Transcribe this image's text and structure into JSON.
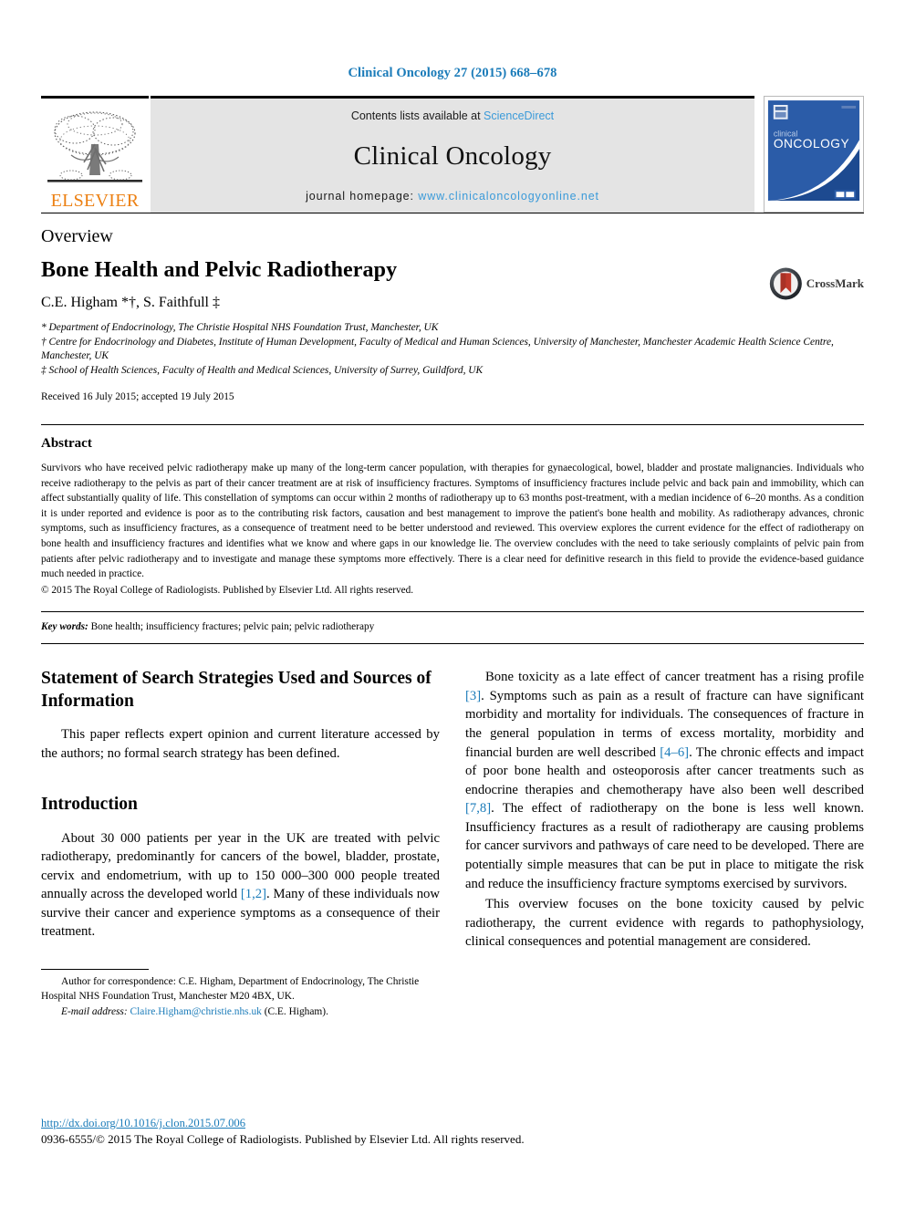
{
  "running_head": "Clinical Oncology 27 (2015) 668–678",
  "masthead": {
    "publisher_name": "ELSEVIER",
    "contents_prefix": "Contents lists available at ",
    "sciencedirect": "ScienceDirect",
    "journal_title": "Clinical Oncology",
    "homepage_label": "journal homepage: ",
    "homepage_url": "www.clinicaloncologyonline.net",
    "cover_line1": "clinical",
    "cover_line2": "ONCOLOGY"
  },
  "article": {
    "section_type": "Overview",
    "title": "Bone Health and Pelvic Radiotherapy",
    "authors": "C.E. Higham *†, S. Faithfull ‡",
    "affiliations": [
      "* Department of Endocrinology, The Christie Hospital NHS Foundation Trust, Manchester, UK",
      "† Centre for Endocrinology and Diabetes, Institute of Human Development, Faculty of Medical and Human Sciences, University of Manchester, Manchester Academic Health Science Centre, Manchester, UK",
      "‡ School of Health Sciences, Faculty of Health and Medical Sciences, University of Surrey, Guildford, UK"
    ],
    "dates": "Received 16 July 2015; accepted 19 July 2015",
    "crossmark_label": "CrossMark"
  },
  "abstract": {
    "heading": "Abstract",
    "text": "Survivors who have received pelvic radiotherapy make up many of the long-term cancer population, with therapies for gynaecological, bowel, bladder and prostate malignancies. Individuals who receive radiotherapy to the pelvis as part of their cancer treatment are at risk of insufficiency fractures. Symptoms of insufficiency fractures include pelvic and back pain and immobility, which can affect substantially quality of life. This constellation of symptoms can occur within 2 months of radiotherapy up to 63 months post-treatment, with a median incidence of 6–20 months. As a condition it is under reported and evidence is poor as to the contributing risk factors, causation and best management to improve the patient's bone health and mobility. As radiotherapy advances, chronic symptoms, such as insufficiency fractures, as a consequence of treatment need to be better understood and reviewed. This overview explores the current evidence for the effect of radiotherapy on bone health and insufficiency fractures and identifies what we know and where gaps in our knowledge lie. The overview concludes with the need to take seriously complaints of pelvic pain from patients after pelvic radiotherapy and to investigate and manage these symptoms more effectively. There is a clear need for definitive research in this field to provide the evidence-based guidance much needed in practice.",
    "copyright": "© 2015 The Royal College of Radiologists. Published by Elsevier Ltd. All rights reserved."
  },
  "keywords": {
    "label": "Key words:",
    "value": " Bone health; insufficiency fractures; pelvic pain; pelvic radiotherapy"
  },
  "body": {
    "left": {
      "heading1": "Statement of Search Strategies Used and Sources of Information",
      "para1": "This paper reflects expert opinion and current literature accessed by the authors; no formal search strategy has been defined.",
      "heading2": "Introduction",
      "para2_a": "About 30 000 patients per year in the UK are treated with pelvic radiotherapy, predominantly for cancers of the bowel, bladder, prostate, cervix and endometrium, with up to 150 000–300 000 people treated annually across the developed world ",
      "para2_ref": "[1,2]",
      "para2_b": ". Many of these individuals now survive their cancer and experience symptoms as a consequence of their treatment."
    },
    "right": {
      "para1_a": "Bone toxicity as a late effect of cancer treatment has a rising profile ",
      "para1_ref1": "[3]",
      "para1_b": ". Symptoms such as pain as a result of fracture can have significant morbidity and mortality for individuals. The consequences of fracture in the general population in terms of excess mortality, morbidity and financial burden are well described ",
      "para1_ref2": "[4–6]",
      "para1_c": ". The chronic effects and impact of poor bone health and osteoporosis after cancer treatments such as endocrine therapies and chemotherapy have also been well described ",
      "para1_ref3": "[7,8]",
      "para1_d": ". The effect of radiotherapy on the bone is less well known. Insufficiency fractures as a result of radiotherapy are causing problems for cancer survivors and pathways of care need to be developed. There are potentially simple measures that can be put in place to mitigate the risk and reduce the insufficiency fracture symptoms exercised by survivors.",
      "para2": "This overview focuses on the bone toxicity caused by pelvic radiotherapy, the current evidence with regards to pathophysiology, clinical consequences and potential management are considered."
    }
  },
  "footnote": {
    "correspondence": "Author for correspondence: C.E. Higham, Department of Endocrinology, The Christie Hospital NHS Foundation Trust, Manchester M20 4BX, UK.",
    "email_label": "E-mail address:",
    "email": "Claire.Higham@christie.nhs.uk",
    "email_suffix": " (C.E. Higham)."
  },
  "footer": {
    "doi": "http://dx.doi.org/10.1016/j.clon.2015.07.006",
    "issn_line": "0936-6555/© 2015 The Royal College of Radiologists. Published by Elsevier Ltd. All rights reserved."
  },
  "colors": {
    "link": "#1a7bb9",
    "elsevier_orange": "#ec8013",
    "banner_gray": "#e4e4e4",
    "cover_blue": "#2b5ca8"
  }
}
